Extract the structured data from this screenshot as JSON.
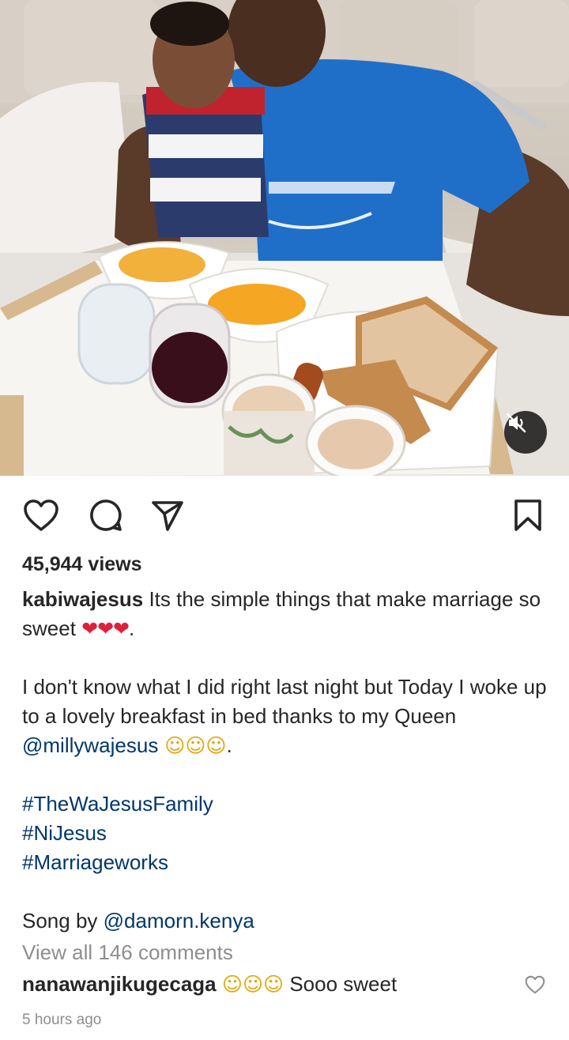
{
  "post": {
    "views": "45,944 views",
    "username": "kabiwajesus",
    "caption_line1": "Its the simple things that make marriage so sweet ",
    "caption_hearts": "❤❤❤",
    "caption_line1_end": ".",
    "caption_para2_a": "I don't know what I did right last night but Today I woke up to a lovely breakfast in bed thanks to my Queen ",
    "caption_mention": "@millywajesus",
    "caption_para2_emoji": " ☺☺☺",
    "caption_para2_end": ".",
    "hashtags": [
      "#TheWaJesusFamily",
      "#NiJesus",
      "#Marriageworks"
    ],
    "song_prefix": "Song by ",
    "song_mention": "@damorn.kenya",
    "view_all_comments": "View all 146 comments",
    "comment": {
      "username": "nanawanjikugecaga",
      "emoji": "☺☺☺",
      "text": "Sooo sweet"
    },
    "timestamp": "5 hours ago"
  },
  "icons": {
    "like": "heart-icon",
    "comment": "comment-icon",
    "share": "send-icon",
    "save": "bookmark-icon",
    "mute": "speaker-muted-icon"
  },
  "colors": {
    "text": "#262626",
    "secondary": "#8e8e8e",
    "link": "#00376b",
    "heart": "#e0203a",
    "shirt_blue": "#1f6fc9"
  }
}
